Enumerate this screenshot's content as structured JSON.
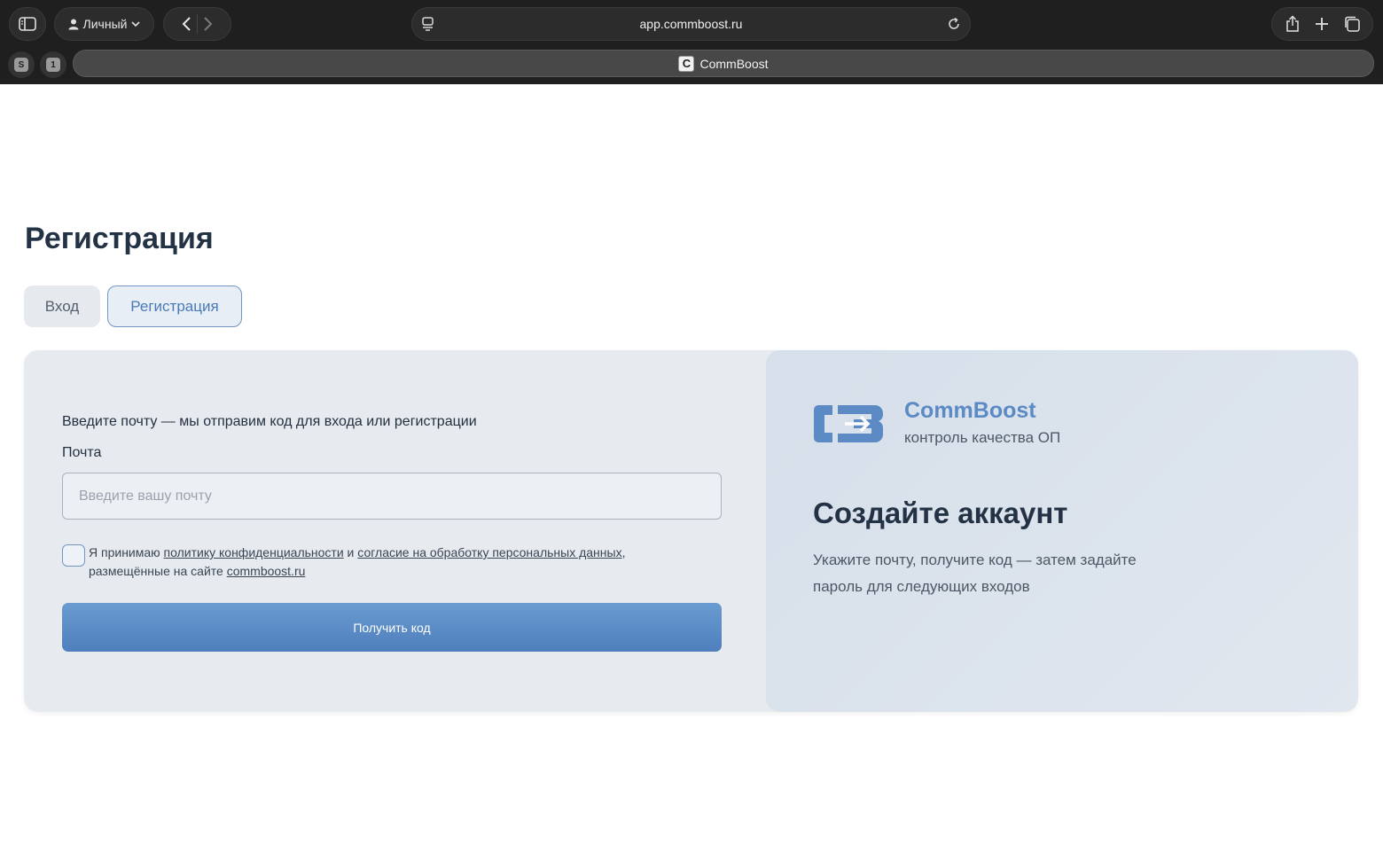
{
  "browser": {
    "profile_label": "Личный",
    "url": "app.commboost.ru",
    "pinned_tabs": [
      "S",
      "1"
    ],
    "active_tab": {
      "favicon_letter": "C",
      "title": "CommBoost"
    }
  },
  "page": {
    "title": "Регистрация",
    "tabs": [
      {
        "label": "Вход",
        "active": false
      },
      {
        "label": "Регистрация",
        "active": true
      }
    ]
  },
  "form": {
    "intro": "Введите почту — мы отправим код для входа или регистрации",
    "email_label": "Почта",
    "email_placeholder": "Введите вашу почту",
    "email_value": "",
    "consent": {
      "checked": false,
      "prefix": "Я принимаю ",
      "link_privacy": "политику конфиденциальности",
      "and": " и ",
      "link_personal_data": "согласие на обработку персональных данных",
      "suffix": ",",
      "site_prefix": "размещённые на сайте ",
      "link_site": "commboost.ru"
    },
    "submit_label": "Получить код"
  },
  "promo": {
    "brand_name": "CommBoost",
    "brand_tagline": "контроль качества ОП",
    "heading": "Создайте аккаунт",
    "description": "Укажите почту, получите код — затем задайте пароль для следующих входов"
  },
  "colors": {
    "accent": "#5b8ac4",
    "button_gradient_top": "#6a9bd0",
    "button_gradient_bottom": "#4f7fbc",
    "heading": "#243246"
  }
}
